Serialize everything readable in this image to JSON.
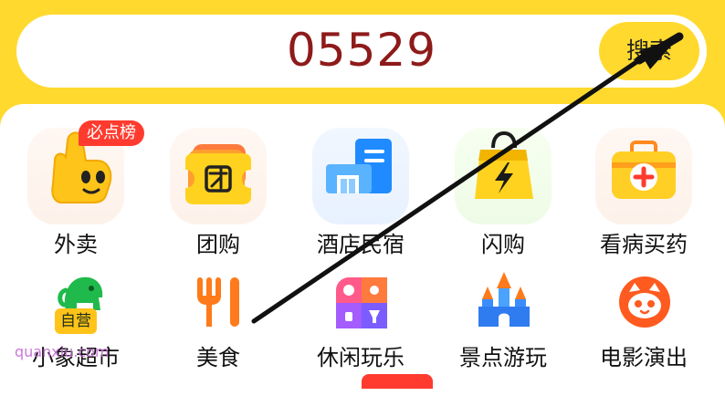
{
  "search": {
    "query": "05529",
    "button_label": "搜索"
  },
  "categories": [
    {
      "label": "外卖",
      "badge": "必点榜",
      "icon": "thumbs-up-mascot-icon"
    },
    {
      "label": "团购",
      "icon": "group-buy-ticket-icon"
    },
    {
      "label": "酒店民宿",
      "icon": "hotel-building-icon"
    },
    {
      "label": "闪购",
      "icon": "lightning-bag-icon"
    },
    {
      "label": "看病买药",
      "icon": "medical-kit-icon"
    },
    {
      "label": "小象超市",
      "badge": "自营",
      "icon": "elephant-icon"
    },
    {
      "label": "美食",
      "icon": "fork-knife-icon"
    },
    {
      "label": "休闲玩乐",
      "icon": "leisure-grid-icon"
    },
    {
      "label": "景点游玩",
      "icon": "castle-icon"
    },
    {
      "label": "电影演出",
      "icon": "cat-face-icon"
    }
  ],
  "watermark": "quanxiu.com",
  "colors": {
    "brand_yellow": "#ffd92e",
    "query_text": "#8e1a1a",
    "badge_red": "#ff3b2f"
  }
}
